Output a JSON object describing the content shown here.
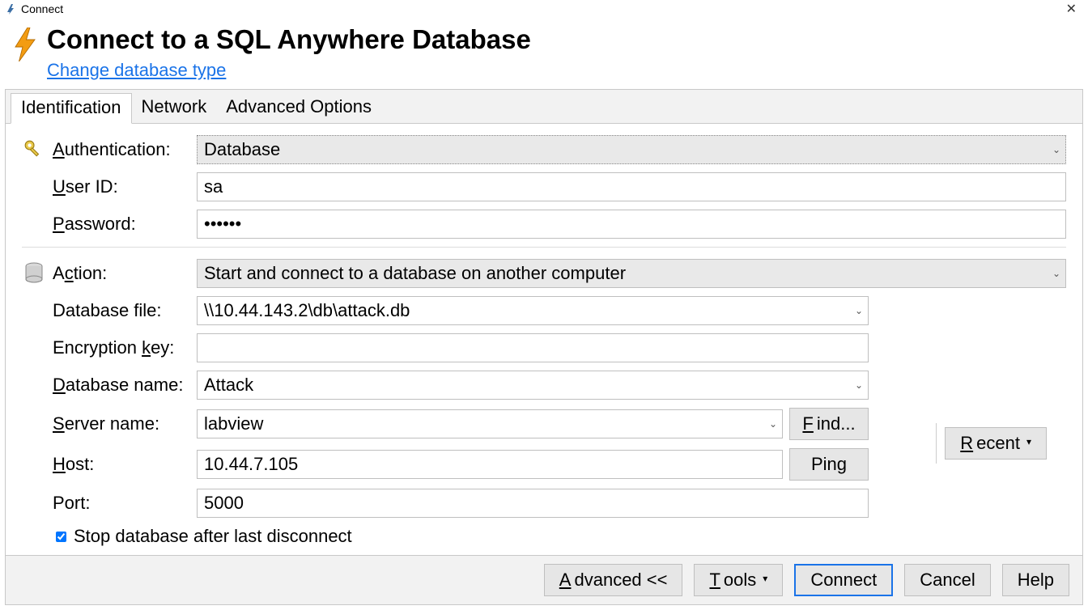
{
  "window": {
    "title": "Connect"
  },
  "header": {
    "title": "Connect to a SQL Anywhere Database",
    "changeLink": "Change database type"
  },
  "tabs": [
    "Identification",
    "Network",
    "Advanced Options"
  ],
  "labels": {
    "authentication": "uthentication:",
    "userId": "ser ID:",
    "password": "assword:",
    "action": "tion:",
    "dbFile": "Database file:",
    "encKey": "Encryption ",
    "encKey2": "ey:",
    "dbName": "atabase name:",
    "serverName": "erver name:",
    "host": "ost:",
    "port": "Port:",
    "stopDb": "Stop database after last disconnect"
  },
  "mnemonics": {
    "authentication": "A",
    "userId": "U",
    "password": "P",
    "action": "c",
    "actionPrefix": "A",
    "encKey": "k",
    "dbName": "D",
    "serverName": "S",
    "host": "H"
  },
  "values": {
    "authentication": "Database",
    "userId": "sa",
    "password": "••••••",
    "action": "Start and connect to a database on another computer",
    "dbFile": "\\\\10.44.143.2\\db\\attack.db",
    "encKey": "",
    "dbName": "Attack",
    "serverName": "labview",
    "host": "10.44.7.105",
    "port": "5000",
    "stopDbChecked": true
  },
  "buttons": {
    "find": "ind...",
    "findM": "F",
    "ping": "Ping",
    "recent": "ecent",
    "recentM": "R",
    "advanced": "dvanced <<",
    "advancedM": "A",
    "tools": "ools",
    "toolsM": "T",
    "connect": "Connect",
    "cancel": "Cancel",
    "help": "Help"
  }
}
